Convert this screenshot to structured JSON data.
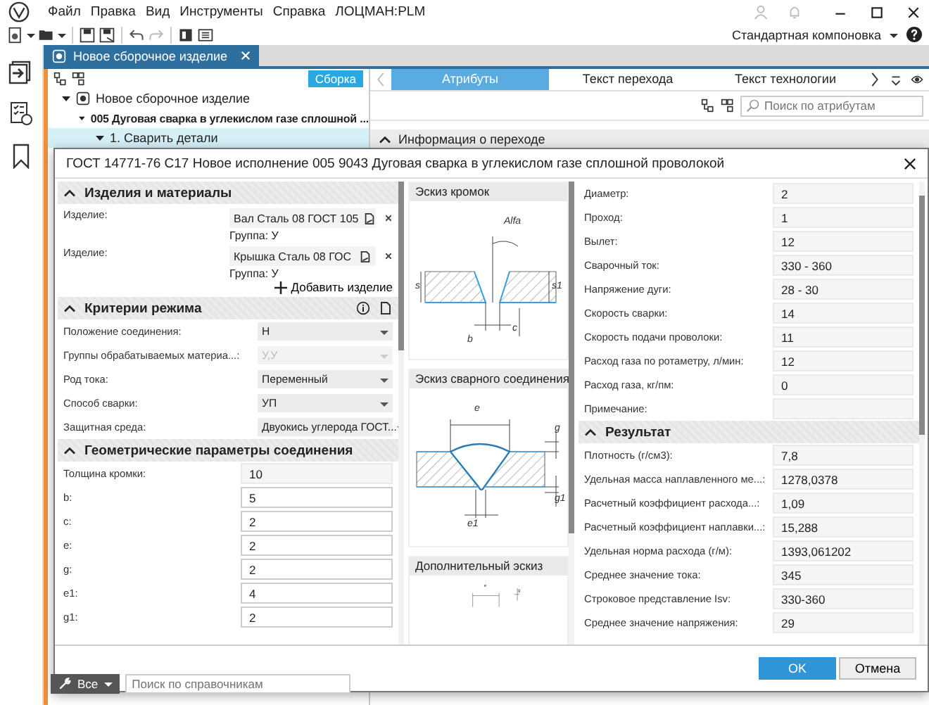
{
  "menu": [
    "Файл",
    "Правка",
    "Вид",
    "Инструменты",
    "Справка",
    "ЛОЦМАН:PLM"
  ],
  "layout_selector": "Стандартная компоновка",
  "document_tab": {
    "title": "Новое сборочное изделие"
  },
  "tree_panel": {
    "badge": "Сборка",
    "nodes": [
      {
        "label": "Новое сборочное изделие",
        "expanded": true,
        "selected": false,
        "children": [
          {
            "label": "005 Дуговая сварка в углекислом газе сплошной  ...",
            "expanded": true,
            "selected": false,
            "children": [
              {
                "label": "1. Сварить детали",
                "expanded": true,
                "selected": true
              }
            ]
          }
        ]
      }
    ]
  },
  "attributes_panel": {
    "tabs": [
      {
        "label": "Атрибуты",
        "selected": true
      },
      {
        "label": "Текст перехода",
        "selected": false
      },
      {
        "label": "Текст технологии",
        "selected": false
      }
    ],
    "search": {
      "placeholder": "Поиск по атрибутам"
    },
    "section": {
      "title": "Информация о переходе",
      "expanded": true
    }
  },
  "reference_search": {
    "scope": "Все",
    "placeholder": "Поиск по справочникам"
  },
  "dialog": {
    "title": "ГОСТ 14771-76 С17 Новое исполнение 005  9043 Дуговая сварка в углекислом газе сплошной проволокой",
    "products": {
      "title": "Изделия и материалы",
      "expanded": true,
      "items": [
        {
          "label": "Изделие:",
          "value": "Вал Сталь 08 ГОСТ 105",
          "group": "Группа: У"
        },
        {
          "label": "Изделие:",
          "value": "Крышка Сталь 08 ГОС",
          "group": "Группа: У"
        }
      ],
      "add_button": "Добавить изделие"
    },
    "criteria": {
      "title": "Критерии режима",
      "expanded": true,
      "fields": [
        {
          "label": "Положение соединения:",
          "value": "Н",
          "disabled": false
        },
        {
          "label": "Группы обрабатываемых материа...:",
          "value": "У,У",
          "disabled": true
        },
        {
          "label": "Род тока:",
          "value": "Переменный",
          "disabled": false
        },
        {
          "label": "Способ сварки:",
          "value": "УП",
          "disabled": false
        },
        {
          "label": "Защитная среда:",
          "value": "Двуокись углерода ГОСТ...",
          "disabled": false
        }
      ]
    },
    "geometry": {
      "title": "Геометрические параметры соединения",
      "expanded": true,
      "fields": [
        {
          "label": "Толщина кромки:",
          "value": "10",
          "readonly": true
        },
        {
          "label": "b:",
          "value": "5",
          "readonly": false
        },
        {
          "label": "c:",
          "value": "2",
          "readonly": false
        },
        {
          "label": "e:",
          "value": "2",
          "readonly": false
        },
        {
          "label": "g:",
          "value": "2",
          "readonly": false
        },
        {
          "label": "e1:",
          "value": "4",
          "readonly": false
        },
        {
          "label": "g1:",
          "value": "2",
          "readonly": false
        }
      ]
    },
    "sketches": [
      {
        "title": "Эскиз кромок",
        "kind": "edge",
        "labels": [
          "Alfa",
          "s",
          "s1",
          "b",
          "c"
        ]
      },
      {
        "title": "Эскиз сварного соединения",
        "kind": "joint",
        "labels": [
          "e",
          "g",
          "e1",
          "g1"
        ]
      },
      {
        "title": "Дополнительный эскиз",
        "kind": "extra",
        "labels": [
          "e",
          "g"
        ]
      }
    ],
    "mode_fields": [
      {
        "label": "Диаметр:",
        "value": "2"
      },
      {
        "label": "Проход:",
        "value": "1"
      },
      {
        "label": "Вылет:",
        "value": "12"
      },
      {
        "label": "Сварочный ток:",
        "value": "330 - 360"
      },
      {
        "label": "Напряжение дуги:",
        "value": "28 - 30"
      },
      {
        "label": "Скорость сварки:",
        "value": "14"
      },
      {
        "label": "Скорость подачи проволоки:",
        "value": "11"
      },
      {
        "label": "Расход газа по ротаметру, л/мин:",
        "value": "12"
      },
      {
        "label": "Расход газа, кг/пм:",
        "value": "0"
      },
      {
        "label": "Примечание:"
      }
    ],
    "result": {
      "title": "Результат",
      "expanded": true,
      "fields": [
        {
          "label": "Плотность (г/см3):",
          "value": "7,8"
        },
        {
          "label": "Удельная масса наплавленного ме...:",
          "value": "1278,0378"
        },
        {
          "label": "Расчетный коэффициент расхода...:",
          "value": "1,09"
        },
        {
          "label": "Расчетный коэффициент наплавки...:",
          "value": "15,288"
        },
        {
          "label": "Удельная норма расхода (г/м):",
          "value": "1393,061202"
        },
        {
          "label": "Среднее значение тока:",
          "value": "345"
        },
        {
          "label": "Строковое представление Isv:",
          "value": "330-360"
        },
        {
          "label": "Среднее значение напряжения:",
          "value": "29"
        }
      ]
    },
    "buttons": {
      "ok": "OK",
      "cancel": "Отмена"
    }
  }
}
